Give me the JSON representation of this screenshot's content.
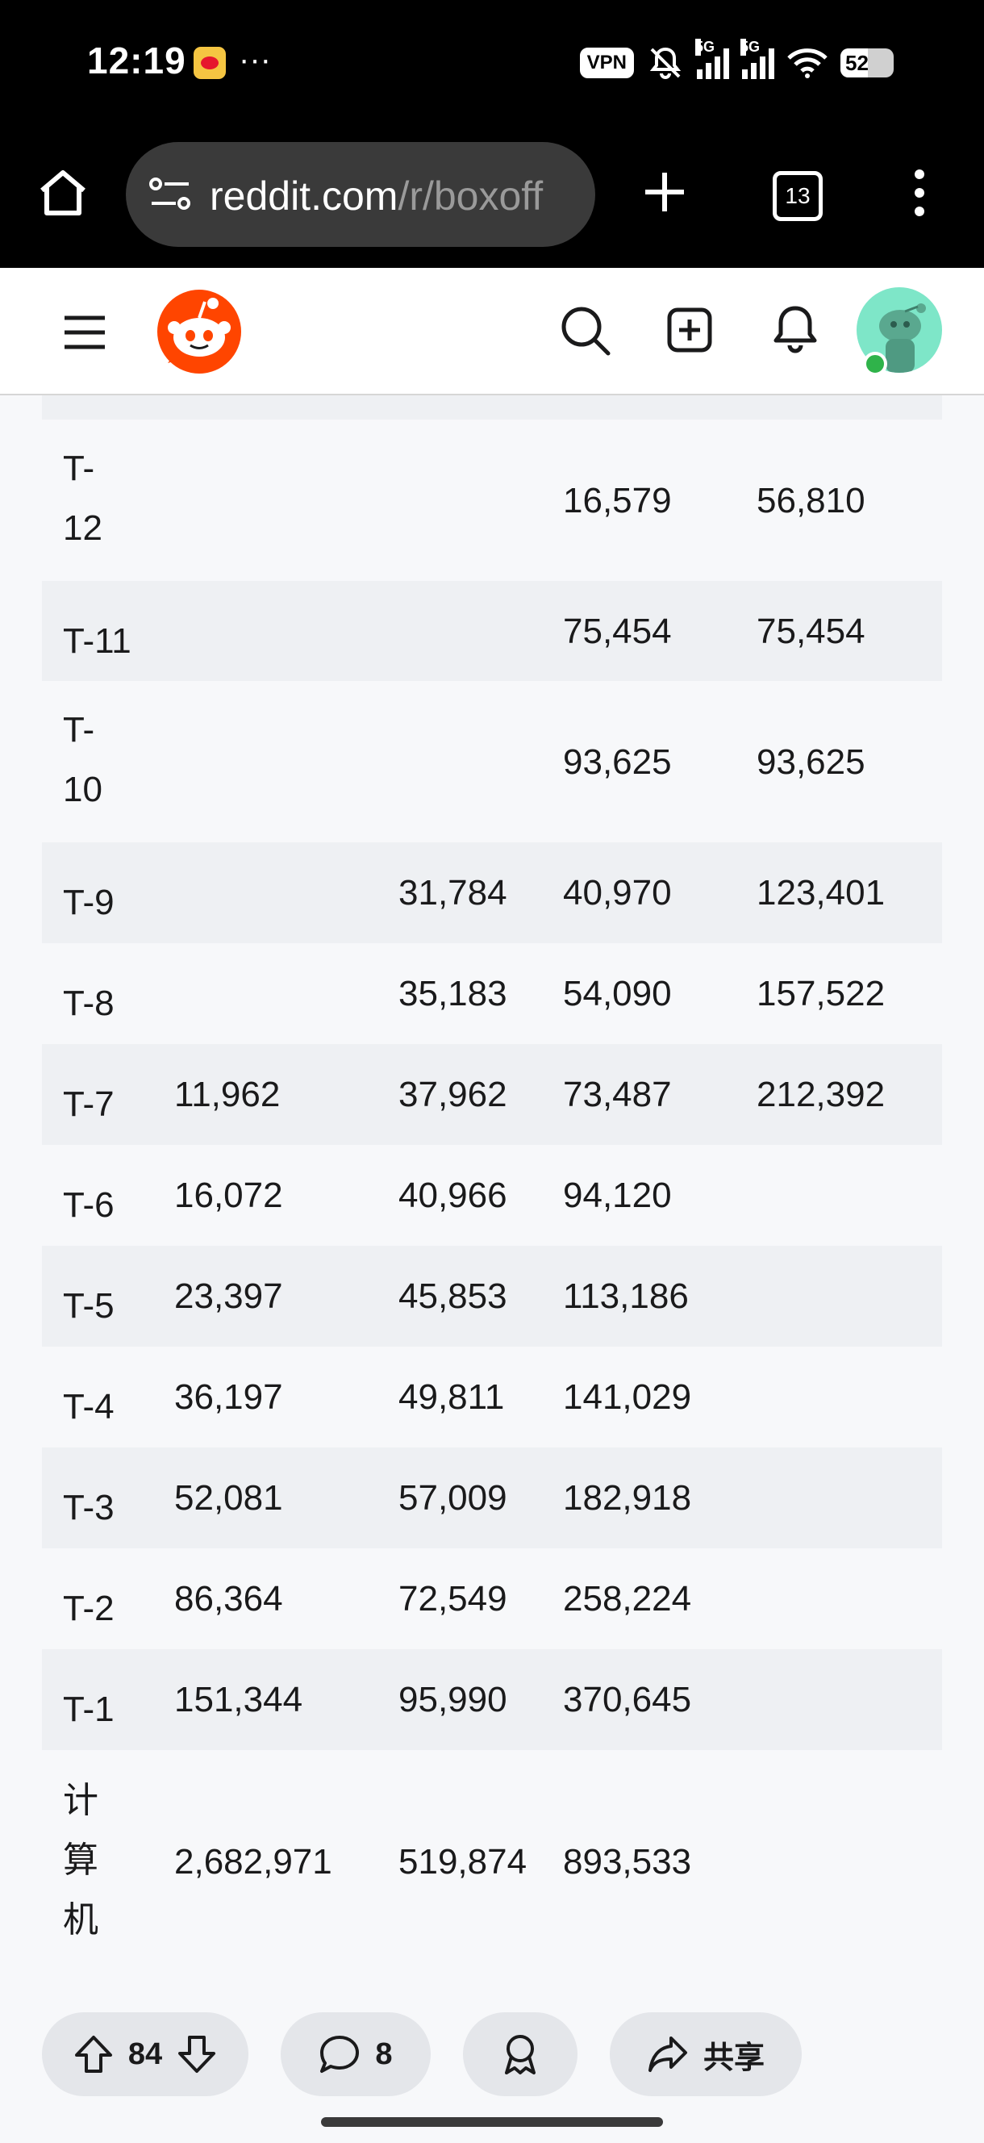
{
  "status_bar": {
    "time": "12:19",
    "more": "···",
    "vpn_label": "VPN",
    "network_1": "5G",
    "network_2": "5G",
    "battery": "52"
  },
  "browser": {
    "url_host": "reddit.com",
    "url_path": "/r/boxoff",
    "tab_count": "13"
  },
  "table": {
    "rows": [
      {
        "label": "T-\n12",
        "c1": "",
        "c2": "",
        "c3": "16,579",
        "c4": "56,810"
      },
      {
        "label": "T-11",
        "c1": "",
        "c2": "",
        "c3": "75,454",
        "c4": "75,454"
      },
      {
        "label": "T-\n10",
        "c1": "",
        "c2": "",
        "c3": "93,625",
        "c4": "93,625"
      },
      {
        "label": "T-9",
        "c1": "",
        "c2": "31,784",
        "c3": "40,970",
        "c4": "123,401"
      },
      {
        "label": "T-8",
        "c1": "",
        "c2": "35,183",
        "c3": "54,090",
        "c4": "157,522"
      },
      {
        "label": "T-7",
        "c1": "11,962",
        "c2": "37,962",
        "c3": "73,487",
        "c4": "212,392"
      },
      {
        "label": "T-6",
        "c1": "16,072",
        "c2": "40,966",
        "c3": "94,120",
        "c4": ""
      },
      {
        "label": "T-5",
        "c1": "23,397",
        "c2": "45,853",
        "c3": "113,186",
        "c4": ""
      },
      {
        "label": "T-4",
        "c1": "36,197",
        "c2": "49,811",
        "c3": "141,029",
        "c4": ""
      },
      {
        "label": "T-3",
        "c1": "52,081",
        "c2": "57,009",
        "c3": "182,918",
        "c4": ""
      },
      {
        "label": "T-2",
        "c1": "86,364",
        "c2": "72,549",
        "c3": "258,224",
        "c4": ""
      },
      {
        "label": "T-1",
        "c1": "151,344",
        "c2": "95,990",
        "c3": "370,645",
        "c4": ""
      },
      {
        "label": "计\n算\n机",
        "c1": "2,682,971",
        "c2": "519,874",
        "c3": "893,533",
        "c4": ""
      }
    ]
  },
  "actions": {
    "vote_count": "84",
    "comment_count": "8",
    "share_label": "共享"
  },
  "colors": {
    "reddit_orange": "#ff4500",
    "page_bg": "#f7f8fa",
    "row_alt": "#eef0f3"
  }
}
